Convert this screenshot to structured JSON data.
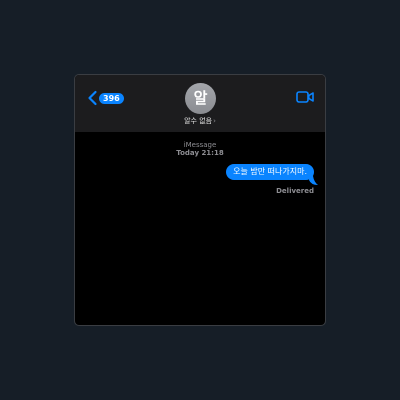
{
  "header": {
    "unread_count": "396",
    "avatar_initial": "알",
    "contact_name": "알수 없음",
    "contact_chevron": "›",
    "back_icon": "chevron-left-icon",
    "video_icon": "video-camera-icon"
  },
  "conversation": {
    "service": "iMessage",
    "timestamp": "Today 21:18",
    "messages": [
      {
        "direction": "outgoing",
        "text": "오늘 밤만 떠나가지마.",
        "status": "Delivered"
      }
    ]
  },
  "colors": {
    "accent": "#0a84ff",
    "background": "#000000",
    "header": "#1c1c1e",
    "secondary_text": "#8e8e93"
  }
}
